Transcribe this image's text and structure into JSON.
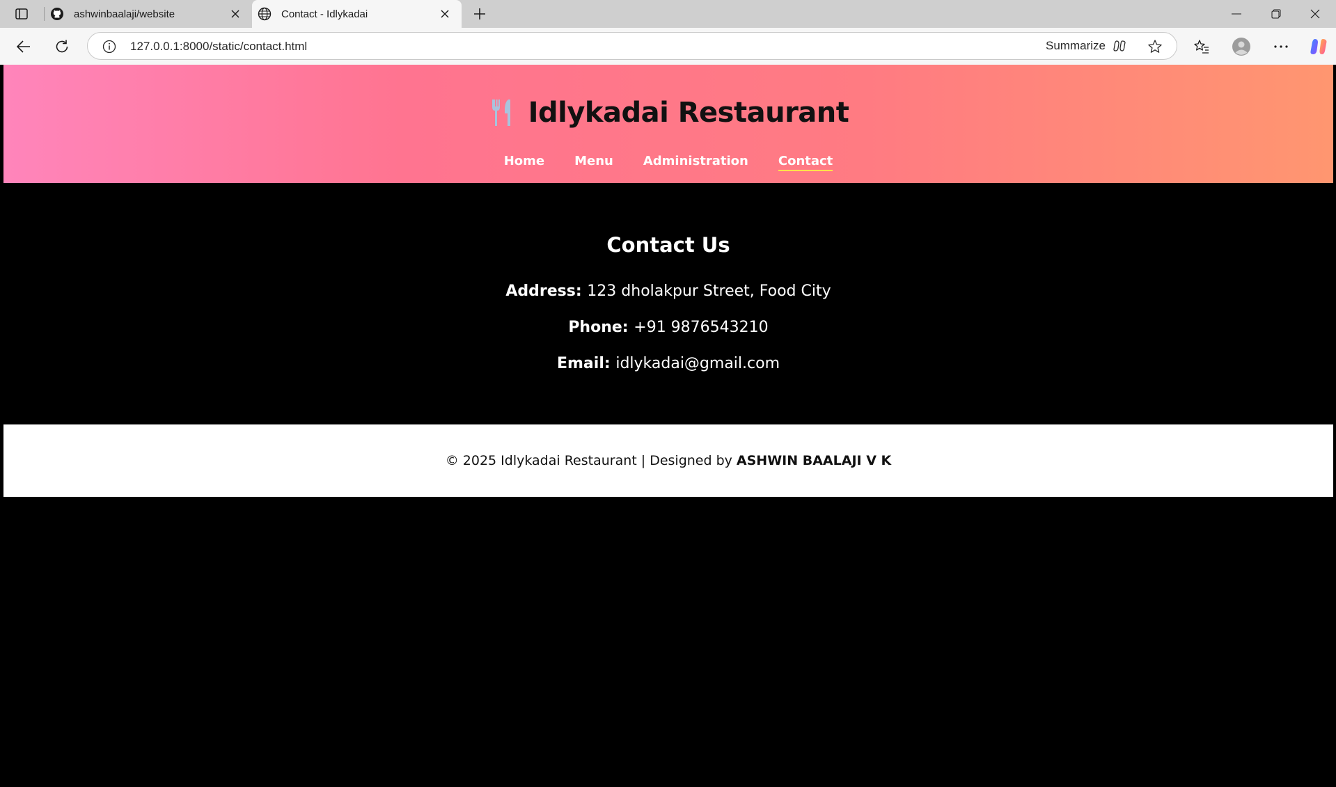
{
  "browser": {
    "tabs": [
      {
        "title": "ashwinbaalaji/website",
        "icon": "github-icon",
        "active": false
      },
      {
        "title": "Contact - Idlykadai",
        "icon": "globe-icon",
        "active": true
      }
    ],
    "url": "127.0.0.1:8000/static/contact.html",
    "summarize_label": "Summarize"
  },
  "site": {
    "brand_name": "Idlykadai Restaurant",
    "brand_icon": "fork-knife-icon",
    "nav": [
      {
        "label": "Home",
        "active": false
      },
      {
        "label": "Menu",
        "active": false
      },
      {
        "label": "Administration",
        "active": false
      },
      {
        "label": "Contact",
        "active": true
      }
    ],
    "colors": {
      "header_gradient": [
        "#ff85bb",
        "#ff7490",
        "#ff7b82",
        "#ff9670"
      ],
      "active_underline": "#ffe14a"
    }
  },
  "contact": {
    "heading": "Contact Us",
    "address_label": "Address:",
    "address_value": "123 dholakpur Street, Food City",
    "phone_label": "Phone:",
    "phone_value": "+91 9876543210",
    "email_label": "Email:",
    "email_value": "idlykadai@gmail.com"
  },
  "footer": {
    "text": "© 2025 Idlykadai Restaurant | Designed by",
    "author": "ASHWIN BAALAJI V K"
  }
}
